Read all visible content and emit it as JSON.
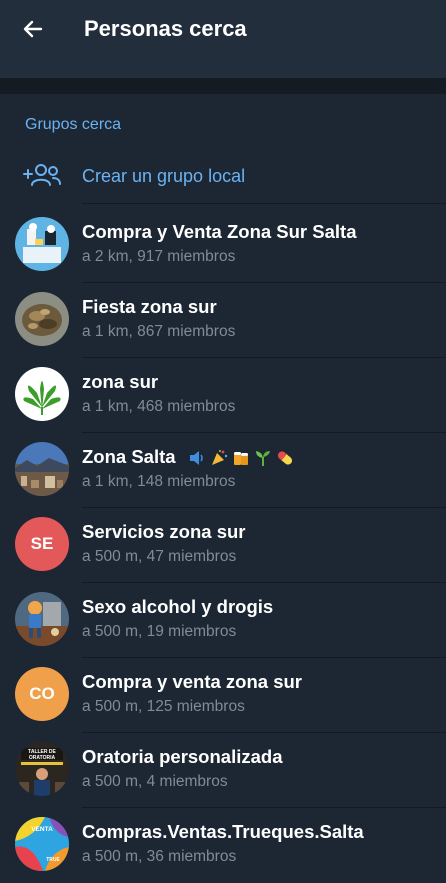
{
  "header": {
    "title": "Personas cerca"
  },
  "section": {
    "title": "Grupos cerca"
  },
  "create": {
    "label": "Crear un grupo local"
  },
  "groups": [
    {
      "name": "Compra y Venta Zona Sur Salta",
      "meta": "a 2 km, 917 miembros",
      "avatar": "photo-market"
    },
    {
      "name": "Fiesta zona sur",
      "meta": "a 1 km, 867 miembros",
      "avatar": "photo-food"
    },
    {
      "name": "zona sur",
      "meta": "a 1 km, 468 miembros",
      "avatar": "cannabis-leaf"
    },
    {
      "name": "Zona Salta",
      "meta": "a 1 km, 148 miembros",
      "avatar": "photo-city",
      "emojis": [
        "speaker-emoji",
        "party-emoji",
        "beer-emoji",
        "sprout-emoji",
        "pill-emoji"
      ]
    },
    {
      "name": "Servicios zona sur",
      "meta": "a 500 m, 47 miembros",
      "initials": "SE",
      "color": "#e35959"
    },
    {
      "name": "Sexo alcohol y drogis",
      "meta": "a 500 m, 19 miembros",
      "avatar": "photo-cartoon"
    },
    {
      "name": "Compra y venta zona sur",
      "meta": "a 500 m, 125 miembros",
      "initials": "CO",
      "color": "#f0a04b"
    },
    {
      "name": "Oratoria personalizada",
      "meta": "a 500 m, 4 miembros",
      "avatar": "photo-poster",
      "avatar_text": "TALLER DE ORATORIA"
    },
    {
      "name": "Compras.Ventas.Trueques.Salta",
      "meta": "a 500 m, 36 miembros",
      "avatar": "photo-colorful",
      "avatar_text": [
        "VENTA",
        "TRUE"
      ]
    }
  ],
  "colors": {
    "accent": "#6ab2f2",
    "background": "#1d2733",
    "header": "#232e3c",
    "subtext": "#7f8b97"
  }
}
